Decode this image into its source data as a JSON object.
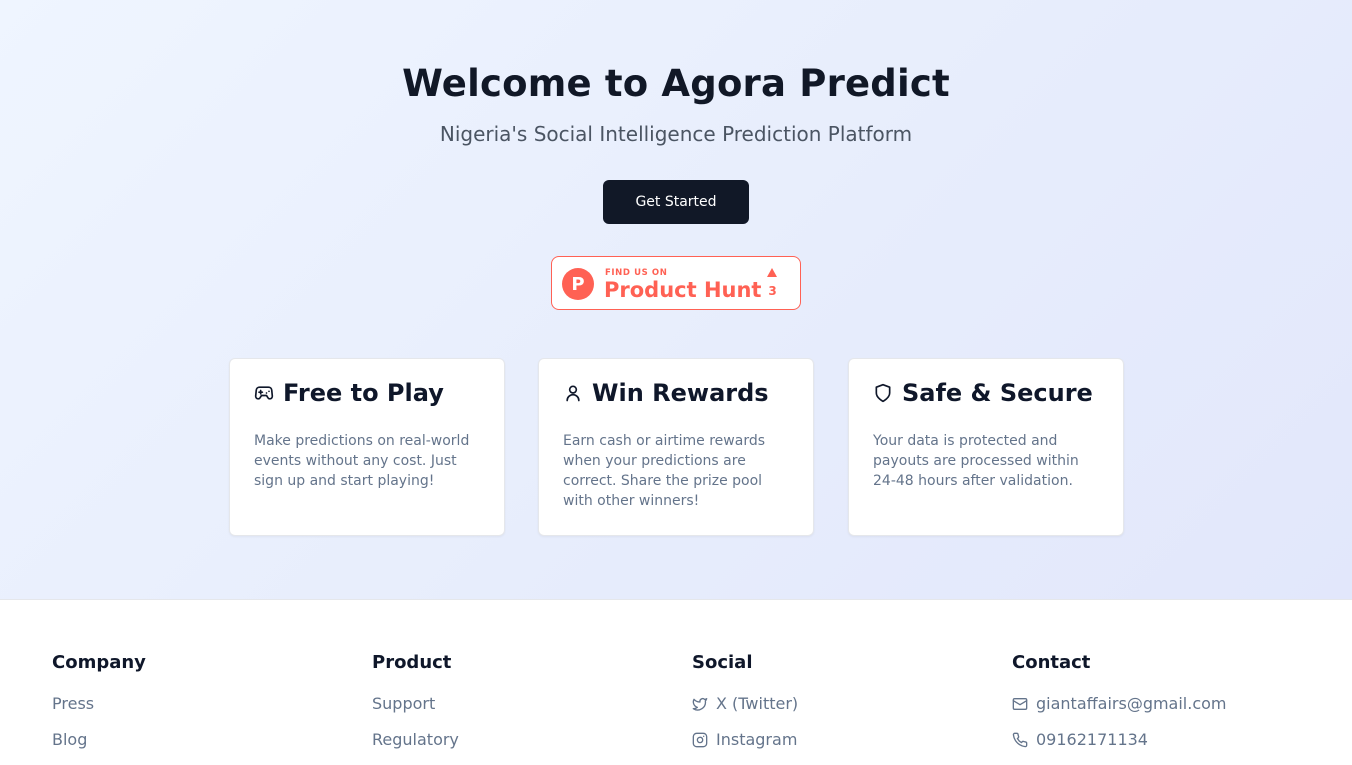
{
  "hero": {
    "title": "Welcome to Agora Predict",
    "subtitle": "Nigeria's Social Intelligence Prediction Platform",
    "cta_label": "Get Started"
  },
  "product_hunt": {
    "tagline": "FIND US ON",
    "name": "Product Hunt",
    "logo_letter": "P",
    "upvotes": "3",
    "color": "#ff6154"
  },
  "features": [
    {
      "icon": "gamepad-icon",
      "title": "Free to Play",
      "description": "Make predictions on real-world events without any cost. Just sign up and start playing!"
    },
    {
      "icon": "user-icon",
      "title": "Win Rewards",
      "description": "Earn cash or airtime rewards when your predictions are correct. Share the prize pool with other winners!"
    },
    {
      "icon": "shield-icon",
      "title": "Safe & Secure",
      "description": "Your data is protected and payouts are processed within 24-48 hours after validation."
    }
  ],
  "footer": {
    "company": {
      "title": "Company",
      "links": [
        "Press",
        "Blog"
      ]
    },
    "product": {
      "title": "Product",
      "links": [
        "Support",
        "Regulatory"
      ]
    },
    "social": {
      "title": "Social",
      "links": [
        {
          "label": "X (Twitter)",
          "icon": "twitter-icon"
        },
        {
          "label": "Instagram",
          "icon": "instagram-icon"
        }
      ]
    },
    "contact": {
      "title": "Contact",
      "links": [
        {
          "label": "giantaffairs@gmail.com",
          "icon": "mail-icon"
        },
        {
          "label": "09162171134",
          "icon": "phone-icon"
        }
      ]
    }
  },
  "colors": {
    "primary": "#111827",
    "accent": "#ff6154",
    "muted_text": "#64748b"
  }
}
